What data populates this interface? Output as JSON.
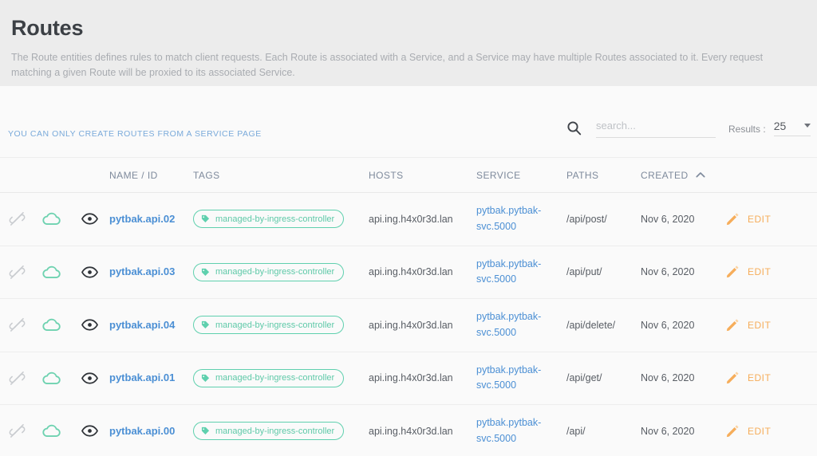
{
  "header": {
    "title": "Routes",
    "description": "The Route entities defines rules to match client requests. Each Route is associated with a Service, and a Service may have multiple Routes associated to it. Every request matching a given Route will be proxied to its associated Service."
  },
  "toolbar": {
    "create_note": "YOU CAN ONLY CREATE ROUTES FROM A SERVICE PAGE",
    "search": {
      "value": "",
      "placeholder": "search..."
    },
    "results_label": "Results :",
    "results_value": "25",
    "results_options": [
      "25"
    ]
  },
  "table": {
    "columns": {
      "name": "NAME / ID",
      "tags": "TAGS",
      "hosts": "HOSTS",
      "service": "SERVICE",
      "paths": "PATHS",
      "created": "CREATED"
    },
    "sort": {
      "column": "CREATED",
      "direction": "asc",
      "icon": "chevron-up-icon"
    },
    "row_icons": [
      "link-off-icon",
      "cloud-icon",
      "eye-icon"
    ],
    "edit_label": "EDIT",
    "edit_icon": "pencil-icon",
    "tag_icon": "tag-icon",
    "rows": [
      {
        "name": "pytbak.api.02",
        "tag": "managed-by-ingress-controller",
        "host": "api.ing.h4x0r3d.lan",
        "service": "pytbak.pytbak-svc.5000",
        "path": "/api/post/",
        "created": "Nov 6, 2020"
      },
      {
        "name": "pytbak.api.03",
        "tag": "managed-by-ingress-controller",
        "host": "api.ing.h4x0r3d.lan",
        "service": "pytbak.pytbak-svc.5000",
        "path": "/api/put/",
        "created": "Nov 6, 2020"
      },
      {
        "name": "pytbak.api.04",
        "tag": "managed-by-ingress-controller",
        "host": "api.ing.h4x0r3d.lan",
        "service": "pytbak.pytbak-svc.5000",
        "path": "/api/delete/",
        "created": "Nov 6, 2020"
      },
      {
        "name": "pytbak.api.01",
        "tag": "managed-by-ingress-controller",
        "host": "api.ing.h4x0r3d.lan",
        "service": "pytbak.pytbak-svc.5000",
        "path": "/api/get/",
        "created": "Nov 6, 2020"
      },
      {
        "name": "pytbak.api.00",
        "tag": "managed-by-ingress-controller",
        "host": "api.ing.h4x0r3d.lan",
        "service": "pytbak.pytbak-svc.5000",
        "path": "/api/",
        "created": "Nov 6, 2020"
      }
    ]
  },
  "colors": {
    "header_bg": "#ececec",
    "page_bg": "#fafafa",
    "title": "#3c4045",
    "muted_text": "#a9acb1",
    "link_blue": "#4b8fd4",
    "note_blue": "#7aaada",
    "tag_green": "#5fd0ae",
    "edit_orange": "#f6ad5a",
    "column_header": "#7e8a9c",
    "border": "#ededed"
  }
}
